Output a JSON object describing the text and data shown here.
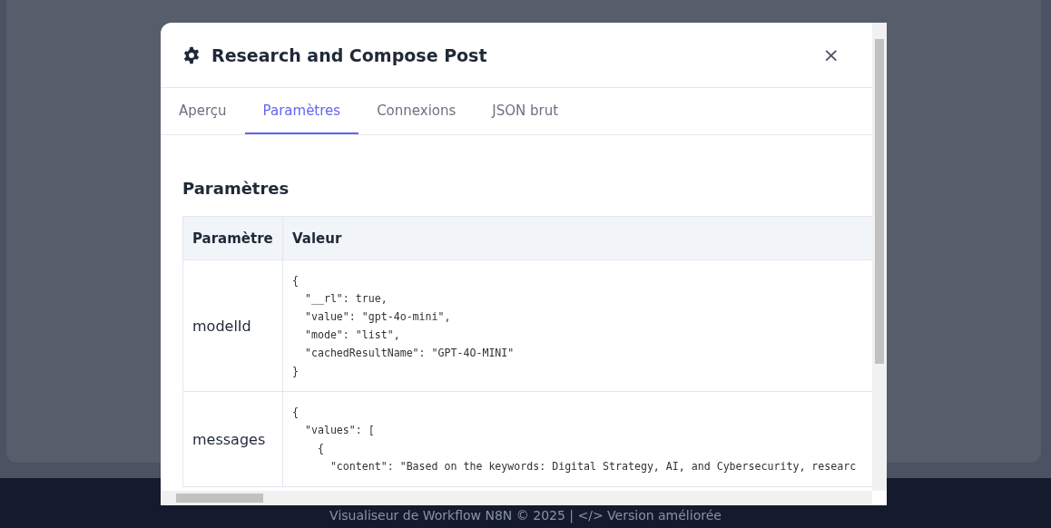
{
  "modal": {
    "title": "Research and Compose Post",
    "close": "×"
  },
  "tabs": [
    {
      "label": "Aperçu",
      "selected": false
    },
    {
      "label": "Paramètres",
      "selected": true
    },
    {
      "label": "Connexions",
      "selected": false
    },
    {
      "label": "JSON brut",
      "selected": false
    }
  ],
  "section_title": "Paramètres",
  "table": {
    "columns": [
      "Paramètre",
      "Valeur"
    ],
    "rows": [
      {
        "name": "modelId",
        "value_lines": [
          "{",
          "  \"__rl\": true,",
          "  \"value\": \"gpt-4o-mini\",",
          "  \"mode\": \"list\",",
          "  \"cachedResultName\": \"GPT-4O-MINI\"",
          "}"
        ]
      },
      {
        "name": "messages",
        "value_lines": [
          "{",
          "  \"values\": [",
          "    {",
          "      \"content\": \"Based on the keywords: Digital Strategy, AI, and Cybersecurity, researc"
        ]
      }
    ]
  },
  "footer": "Visualiseur de Workflow N8N © 2025 | </> Version améliorée"
}
